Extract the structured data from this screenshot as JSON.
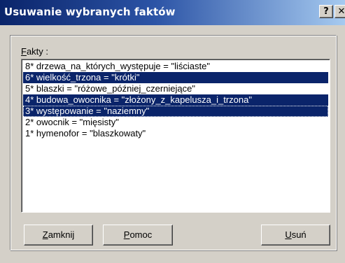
{
  "window": {
    "title": "Usuwanie wybranych faktów",
    "help_button": "?",
    "close_button": "✕"
  },
  "facts": {
    "label_accel": "F",
    "label_rest": "akty :",
    "items": [
      {
        "text": "8* drzewa_na_których_występuje = \"liściaste\"",
        "selected": false
      },
      {
        "text": "6* wielkość_trzona = \"krótki\"",
        "selected": true
      },
      {
        "text": "5* blaszki = \"różowe_później_czerniejące\"",
        "selected": false
      },
      {
        "text": "4* budowa_owocnika = \"złożony_z_kapelusza_i_trzona\"",
        "selected": true
      },
      {
        "text": "3* występowanie = \"naziemny\"",
        "selected": true
      },
      {
        "text": "2* owocnik = \"mięsisty\"",
        "selected": false
      },
      {
        "text": "1* hymenofor = \"blaszkowaty\"",
        "selected": false
      }
    ]
  },
  "buttons": {
    "close": {
      "accel": "Z",
      "rest": "amknij"
    },
    "help": {
      "accel": "P",
      "rest": "omoc"
    },
    "delete": {
      "accel": "U",
      "rest": "suń"
    }
  },
  "colors": {
    "selection": "#0a246a",
    "titlebar_start": "#0a246a",
    "titlebar_end": "#a6caf0",
    "face": "#d4d0c8"
  }
}
